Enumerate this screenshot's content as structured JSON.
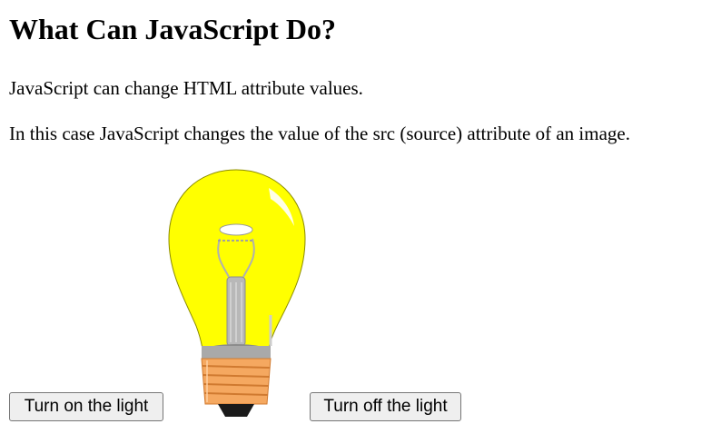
{
  "page": {
    "heading": "What Can JavaScript Do?",
    "paragraph_1": "JavaScript can change HTML attribute values.",
    "paragraph_2": "In this case JavaScript changes the value of the src (source) attribute of an image."
  },
  "controls": {
    "turn_on_label": "Turn on the light",
    "turn_off_label": "Turn off the light"
  },
  "bulb": {
    "icon": "lightbulb-on-icon",
    "state": "on",
    "glass_color": "#ffff00",
    "base_color": "#f5a860"
  }
}
